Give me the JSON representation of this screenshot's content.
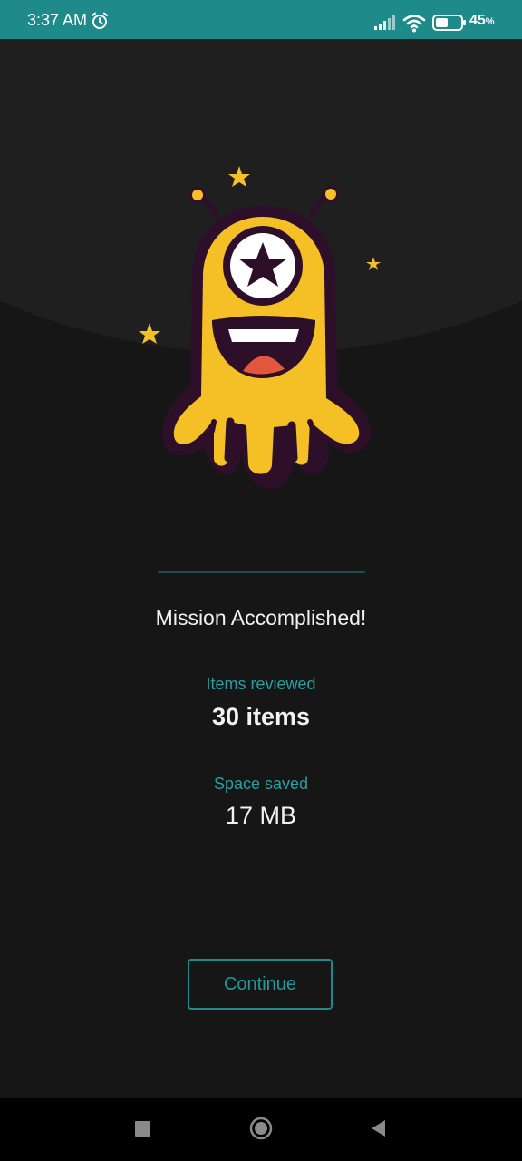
{
  "status_bar": {
    "time": "3:37 AM",
    "battery_percent": "45",
    "battery_suffix": "%",
    "icons": [
      "alarm-icon",
      "signal-icon",
      "wifi-icon",
      "battery-icon"
    ]
  },
  "mascot": {
    "icon": "alien-mascot-illustration"
  },
  "result": {
    "title": "Mission Accomplished!",
    "items_label": "Items reviewed",
    "items_value": "30 items",
    "space_label": "Space saved",
    "space_value": "17 MB"
  },
  "actions": {
    "continue_label": "Continue"
  },
  "nav_bar": {
    "icons": [
      "recent-apps-icon",
      "home-icon",
      "back-icon"
    ]
  },
  "colors": {
    "accent": "#1f8a8a",
    "background": "#161616",
    "mascot_yellow": "#f5c026",
    "mascot_outline": "#2e0f2a"
  }
}
